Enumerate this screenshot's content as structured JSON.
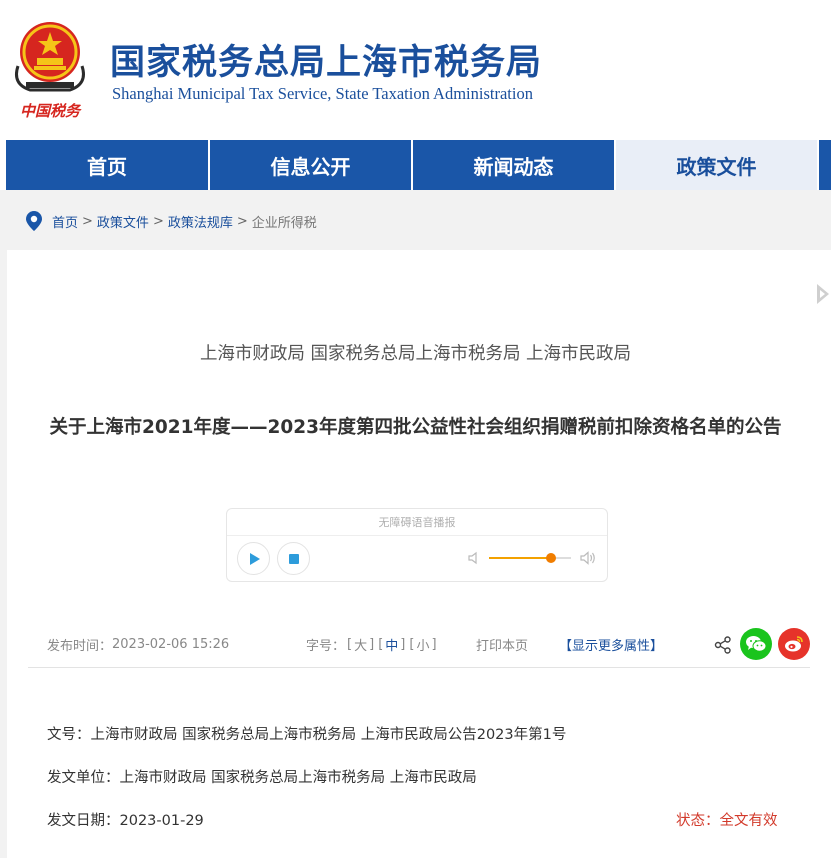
{
  "header": {
    "title": "国家税务总局上海市税务局",
    "subtitle": "Shanghai Municipal Tax Service, State Taxation Administration",
    "logo_text": "中国税务"
  },
  "nav": {
    "items": [
      {
        "label": "首页"
      },
      {
        "label": "信息公开"
      },
      {
        "label": "新闻动态"
      },
      {
        "label": "政策文件"
      }
    ]
  },
  "breadcrumb": {
    "items": [
      "首页",
      "政策文件",
      "政策法规库"
    ],
    "current": "企业所得税",
    "separator": ">"
  },
  "article": {
    "issuer": "上海市财政局 国家税务总局上海市税务局 上海市民政局",
    "title": "关于上海市2021年度——2023年度第四批公益性社会组织捐赠税前扣除资格名单的公告"
  },
  "player": {
    "label": "无障碍语音播报",
    "volume": 0.75
  },
  "meta": {
    "publish_label": "发布时间：",
    "publish_time": "2023-02-06 15:26",
    "font_label": "字号：",
    "font_large": "大",
    "font_medium": "中",
    "font_small": "小",
    "print_label": "打印本页",
    "more_attr": "【显示更多属性】"
  },
  "fields": {
    "doc_no_label": "文号：",
    "doc_no": "上海市财政局 国家税务总局上海市税务局 上海市民政局公告2023年第1号",
    "unit_label": "发文单位：",
    "unit": "上海市财政局 国家税务总局上海市税务局 上海市民政局",
    "date_label": "发文日期：",
    "date": "2023-01-29",
    "status_label": "状态：",
    "status": "全文有效"
  },
  "colors": {
    "brand_blue": "#1a4f9c",
    "nav_blue": "#1a56a8",
    "status_red": "#d23a2b",
    "wechat_green": "#1ac41d",
    "weibo_red": "#e6332a"
  }
}
